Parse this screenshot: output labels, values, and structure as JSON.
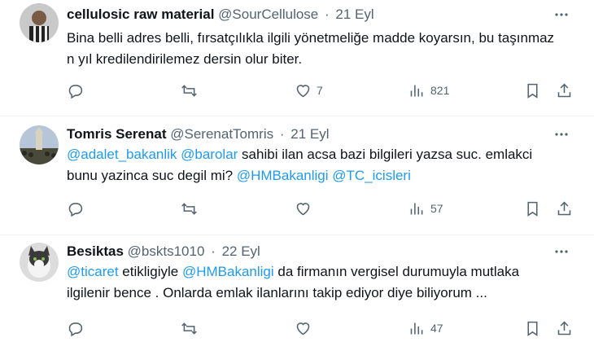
{
  "tweets": [
    {
      "name": "cellulosic raw material",
      "handle": "@SourCellulose",
      "date": "21 Eyl",
      "segments": [
        {
          "text": "Bina belli adres belli, fırsatçılıkla ilgili yönetmeliğe madde koyarsın, bu taşınmaz n yıl kredilendirilemez dersin olur biter.",
          "mention": false
        }
      ],
      "likes": "7",
      "views": "821",
      "avatar_color": "#6b6b6b"
    },
    {
      "name": "Tomris Serenat",
      "handle": "@SerenatTomris",
      "date": "21 Eyl",
      "segments": [
        {
          "text": "@adalet_bakanlik",
          "mention": true
        },
        {
          "text": "  ",
          "mention": false
        },
        {
          "text": "@barolar",
          "mention": true
        },
        {
          "text": " sahibi ilan acsa bazi bilgileri yazsa suc. emlakci bunu yazinca suc degil mi? ",
          "mention": false
        },
        {
          "text": "@HMBakanligi",
          "mention": true
        },
        {
          "text": " ",
          "mention": false
        },
        {
          "text": "@TC_icisleri",
          "mention": true
        }
      ],
      "likes": "",
      "views": "57",
      "avatar_color": "#8a99a8"
    },
    {
      "name": "Besiktas",
      "handle": "@bskts1010",
      "date": "22 Eyl",
      "segments": [
        {
          "text": "@ticaret",
          "mention": true
        },
        {
          "text": " etikligiyle  ",
          "mention": false
        },
        {
          "text": "@HMBakanligi",
          "mention": true
        },
        {
          "text": " da firmanın vergisel durumuyla  mutlaka ilgilenir bence . Onlarda  emlak ilanlarını takip ediyor diye biliyorum ...",
          "mention": false
        }
      ],
      "likes": "",
      "views": "47",
      "avatar_color": "#9a9a9a"
    }
  ],
  "colors": {
    "text": "#0f1419",
    "secondary": "#536471",
    "mention": "#1d9bf0",
    "divider": "#eff3f4"
  },
  "icons": [
    "reply-icon",
    "retweet-icon",
    "like-icon",
    "views-icon",
    "bookmark-icon",
    "share-icon",
    "more-icon"
  ]
}
